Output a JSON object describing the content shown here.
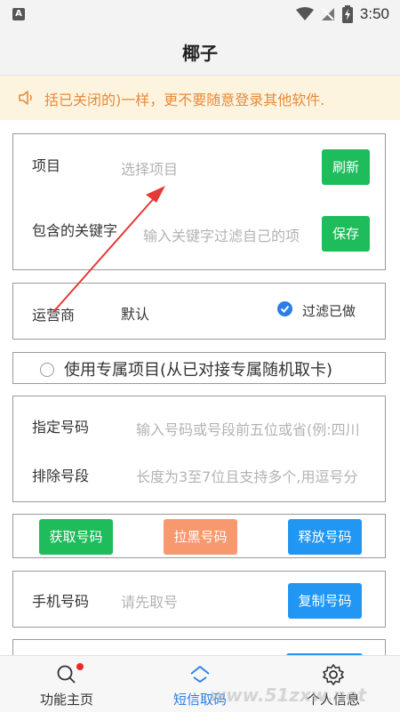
{
  "status_bar": {
    "app_badge": "A",
    "time": "3:50"
  },
  "header": {
    "title": "椰子"
  },
  "notice": {
    "text": "括已关闭的)一样，更不要随意登录其他软件."
  },
  "project_card": {
    "project_label": "项目",
    "project_placeholder": "选择项目",
    "refresh_button": "刷新",
    "keyword_label": "包含的关键字",
    "keyword_placeholder": "输入关键字过滤自己的项",
    "save_button": "保存"
  },
  "carrier_card": {
    "carrier_label": "运营商",
    "carrier_value": "默认",
    "filter_done_label": "过滤已做",
    "filter_done_checked": true
  },
  "exclusive": {
    "label": "使用专属项目(从已对接专属随机取卡)",
    "checked": false
  },
  "number_card": {
    "designated_label": "指定号码",
    "designated_placeholder": "输入号码或号段前五位或省(例:四川",
    "exclude_label": "排除号段",
    "exclude_placeholder": "长度为3至7位且支持多个,用逗号分"
  },
  "actions": {
    "get_number": "获取号码",
    "blacklist_number": "拉黑号码",
    "release_number": "释放号码"
  },
  "phone_card": {
    "phone_label": "手机号码",
    "phone_placeholder": "请先取号",
    "copy_button": "复制号码"
  },
  "tabs": [
    {
      "label": "功能主页",
      "icon": "search-icon"
    },
    {
      "label": "短信取码",
      "icon": "home-icon"
    },
    {
      "label": "个人信息",
      "icon": "gear-icon"
    }
  ],
  "watermark": "www.51zxw.net",
  "colors": {
    "green": "#1fbc5b",
    "blue": "#2196f3",
    "orange": "#f8986e",
    "notice_text": "#e78a3a",
    "accent": "#2a7ee6"
  }
}
